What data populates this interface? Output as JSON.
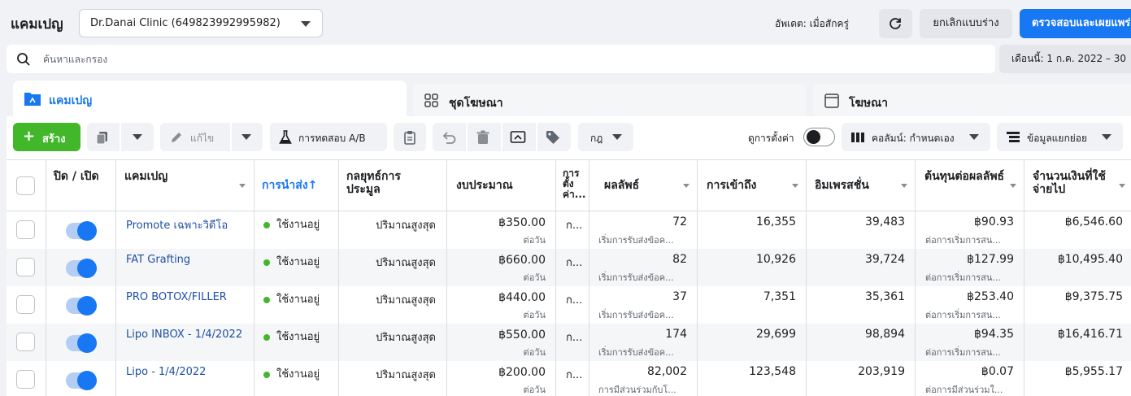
{
  "header": {
    "title": "แคมเปญ",
    "account": "Dr.Danai Clinic (649823992995982)",
    "update_status": "อัพเดต: เมื่อสักครู่",
    "discard_label": "ยกเลิกแบบร่าง",
    "publish_label": "ตรวจสอบและเผยแพร่"
  },
  "search": {
    "placeholder": "ค้นหาและกรอง",
    "value": ""
  },
  "date_range": "เดือนนี้: 1 ก.ค. 2022 – 30",
  "tabs": [
    {
      "label": "แคมเปญ"
    },
    {
      "label": "ชุดโฆษณา"
    },
    {
      "label": "โฆษณา"
    }
  ],
  "toolbar": {
    "create_label": "สร้าง",
    "edit_label": "แก้ไข",
    "ab_test_label": "การทดสอบ A/B",
    "rules_label": "กฎ",
    "view_settings_label": "ดูการตั้งค่า",
    "columns_label": "คอลัมน์: กำหนดเอง",
    "breakdown_label": "ข้อมูลแยกย่อย"
  },
  "table": {
    "headers": {
      "toggle": "ปิด / เปิด",
      "campaign": "แคมเปญ",
      "delivery": "การนำส่ง",
      "bid_strategy": "กลยุทธ์การประมูล",
      "budget": "งบประมาณ",
      "attribution": "การตั้งค่า...",
      "results": "ผลลัพธ์",
      "reach": "การเข้าถึง",
      "impressions": "อิมเพรสชั่น",
      "cost_per_result": "ต้นทุนต่อผลลัพธ์",
      "amount_spent": "จำนวนเงินที่ใช้จ่ายไป"
    },
    "rows": [
      {
        "name": "Promote เฉพาะวิดีโอ",
        "delivery": "ใช้งานอยู่",
        "bid": "ปริมาณสูงสุด",
        "budget": "฿350.00",
        "budget_period": "ต่อวัน",
        "attr": "ก...",
        "results": "72",
        "results_type": "เริ่มการรับส่งข้อค...",
        "reach": "16,355",
        "impressions": "39,483",
        "cpr": "฿90.93",
        "cpr_type": "ต่อการเริ่มการสน...",
        "spent": "฿6,546.60"
      },
      {
        "name": "FAT Grafting",
        "delivery": "ใช้งานอยู่",
        "bid": "ปริมาณสูงสุด",
        "budget": "฿660.00",
        "budget_period": "ต่อวัน",
        "attr": "ก...",
        "results": "82",
        "results_type": "เริ่มการรับส่งข้อค...",
        "reach": "10,926",
        "impressions": "39,724",
        "cpr": "฿127.99",
        "cpr_type": "ต่อการเริ่มการสน...",
        "spent": "฿10,495.40"
      },
      {
        "name": "PRO BOTOX/FILLER",
        "delivery": "ใช้งานอยู่",
        "bid": "ปริมาณสูงสุด",
        "budget": "฿440.00",
        "budget_period": "ต่อวัน",
        "attr": "ก...",
        "results": "37",
        "results_type": "เริ่มการรับส่งข้อค...",
        "reach": "7,351",
        "impressions": "35,361",
        "cpr": "฿253.40",
        "cpr_type": "ต่อการเริ่มการสน...",
        "spent": "฿9,375.75"
      },
      {
        "name": "Lipo INBOX - 1/4/2022",
        "delivery": "ใช้งานอยู่",
        "bid": "ปริมาณสูงสุด",
        "budget": "฿550.00",
        "budget_period": "ต่อวัน",
        "attr": "ก...",
        "results": "174",
        "results_type": "เริ่มการรับส่งข้อค...",
        "reach": "29,699",
        "impressions": "98,894",
        "cpr": "฿94.35",
        "cpr_type": "ต่อการเริ่มการสน...",
        "spent": "฿16,416.71"
      },
      {
        "name": "Lipo - 1/4/2022",
        "delivery": "ใช้งานอยู่",
        "bid": "ปริมาณสูงสุด",
        "budget": "฿200.00",
        "budget_period": "ต่อวัน",
        "attr": "ก...",
        "results": "82,002",
        "results_type": "การมีส่วนร่วมกับโ...",
        "reach": "123,548",
        "impressions": "203,919",
        "cpr": "฿0.07",
        "cpr_type": "ต่อการมีส่วนร่วมใ...",
        "spent": "฿5,955.17"
      }
    ]
  },
  "colors": {
    "accent": "#1877f2",
    "create": "#42b72a",
    "active_dot": "#42b72a",
    "link": "#1f4fa6"
  }
}
